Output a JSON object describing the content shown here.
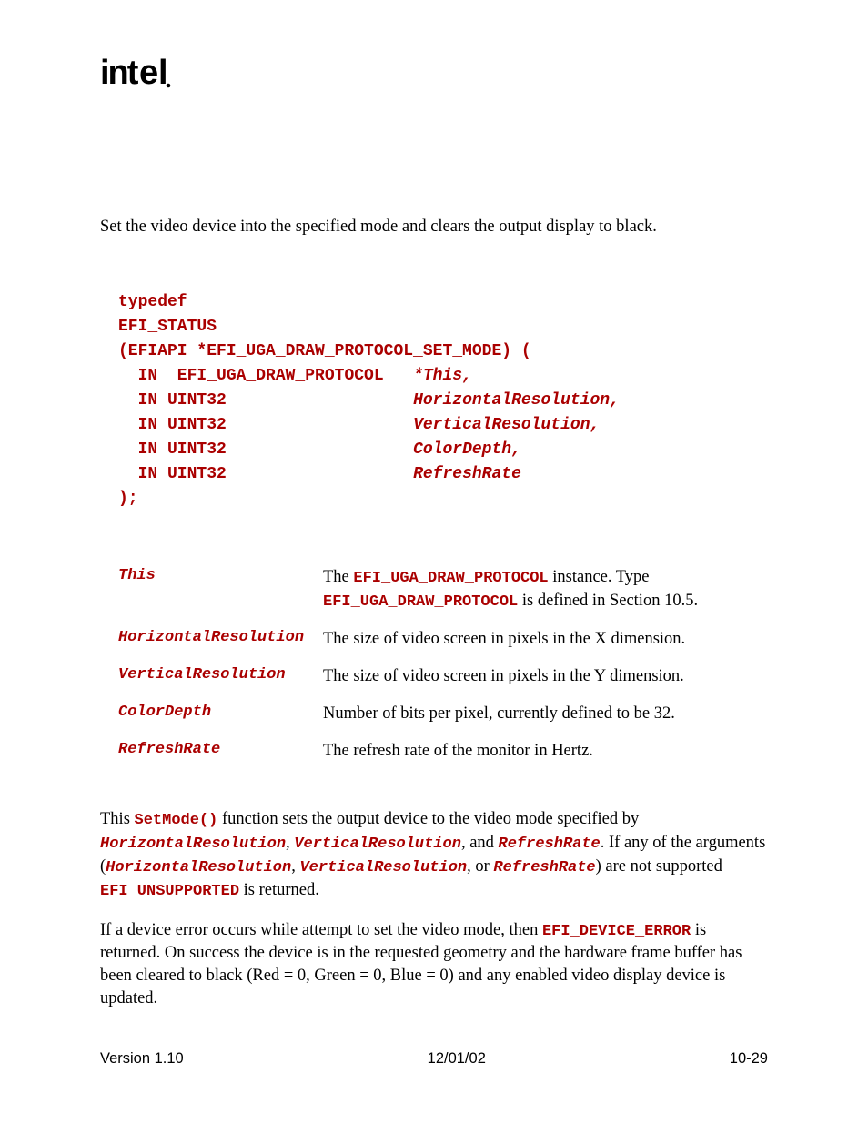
{
  "logo_text": "intel",
  "summary": "Set the video device into the specified mode and clears the output display to black.",
  "prototype": {
    "l1": "typedef",
    "l2": "EFI_STATUS",
    "l3a": "(EFIAPI *EFI_UGA_DRAW_PROTOCOL_SET_MODE) (",
    "l4_kw": "  IN  EFI_UGA_DRAW_PROTOCOL   ",
    "l4_it": "*This,",
    "l5_kw": "  IN UINT32                   ",
    "l5_it": "HorizontalResolution,",
    "l6_kw": "  IN UINT32                   ",
    "l6_it": "VerticalResolution,",
    "l7_kw": "  IN UINT32                   ",
    "l7_it": "ColorDepth,",
    "l8_kw": "  IN UINT32                   ",
    "l8_it": "RefreshRate",
    "l9": "  );"
  },
  "params": [
    {
      "name": "This",
      "desc_pre": "The ",
      "code1": "EFI_UGA_DRAW_PROTOCOL",
      "desc_mid": " instance.  Type ",
      "code2": "EFI_UGA_DRAW_PROTOCOL",
      "desc_post": " is defined in Section 10.5."
    },
    {
      "name": "HorizontalResolution",
      "desc_plain": "The size of video screen in pixels in the X dimension."
    },
    {
      "name": "VerticalResolution",
      "desc_plain": "The size of video screen in pixels in the Y dimension."
    },
    {
      "name": "ColorDepth",
      "desc_plain": "Number of bits per pixel, currently defined to be 32."
    },
    {
      "name": "RefreshRate",
      "desc_plain": "The refresh rate of the monitor in Hertz."
    }
  ],
  "description": {
    "p1": {
      "t1": "This ",
      "c1": "SetMode()",
      "t2": " function sets the output device to the video mode specified by ",
      "i1": "HorizontalResolution",
      "t3": ", ",
      "i2": "VerticalResolution",
      "t4": ", and ",
      "i3": "RefreshRate",
      "t5": ".  If any of the arguments (",
      "i4": "HorizontalResolution",
      "t6": ", ",
      "i5": "VerticalResolution",
      "t7": ", or ",
      "i6": "RefreshRate",
      "t8": ") are not supported ",
      "c2": "EFI_UNSUPPORTED",
      "t9": " is returned."
    },
    "p2": {
      "t1": "If a device error occurs while attempt to set the video mode, then ",
      "c1": "EFI_DEVICE_ERROR",
      "t2": " is returned.  On success the device is in the requested geometry and the hardware frame buffer has been cleared to black (Red = 0, Green = 0, Blue = 0) and any enabled video display device is updated."
    }
  },
  "footer": {
    "left": "Version 1.10",
    "center": "12/01/02",
    "right": "10-29"
  }
}
